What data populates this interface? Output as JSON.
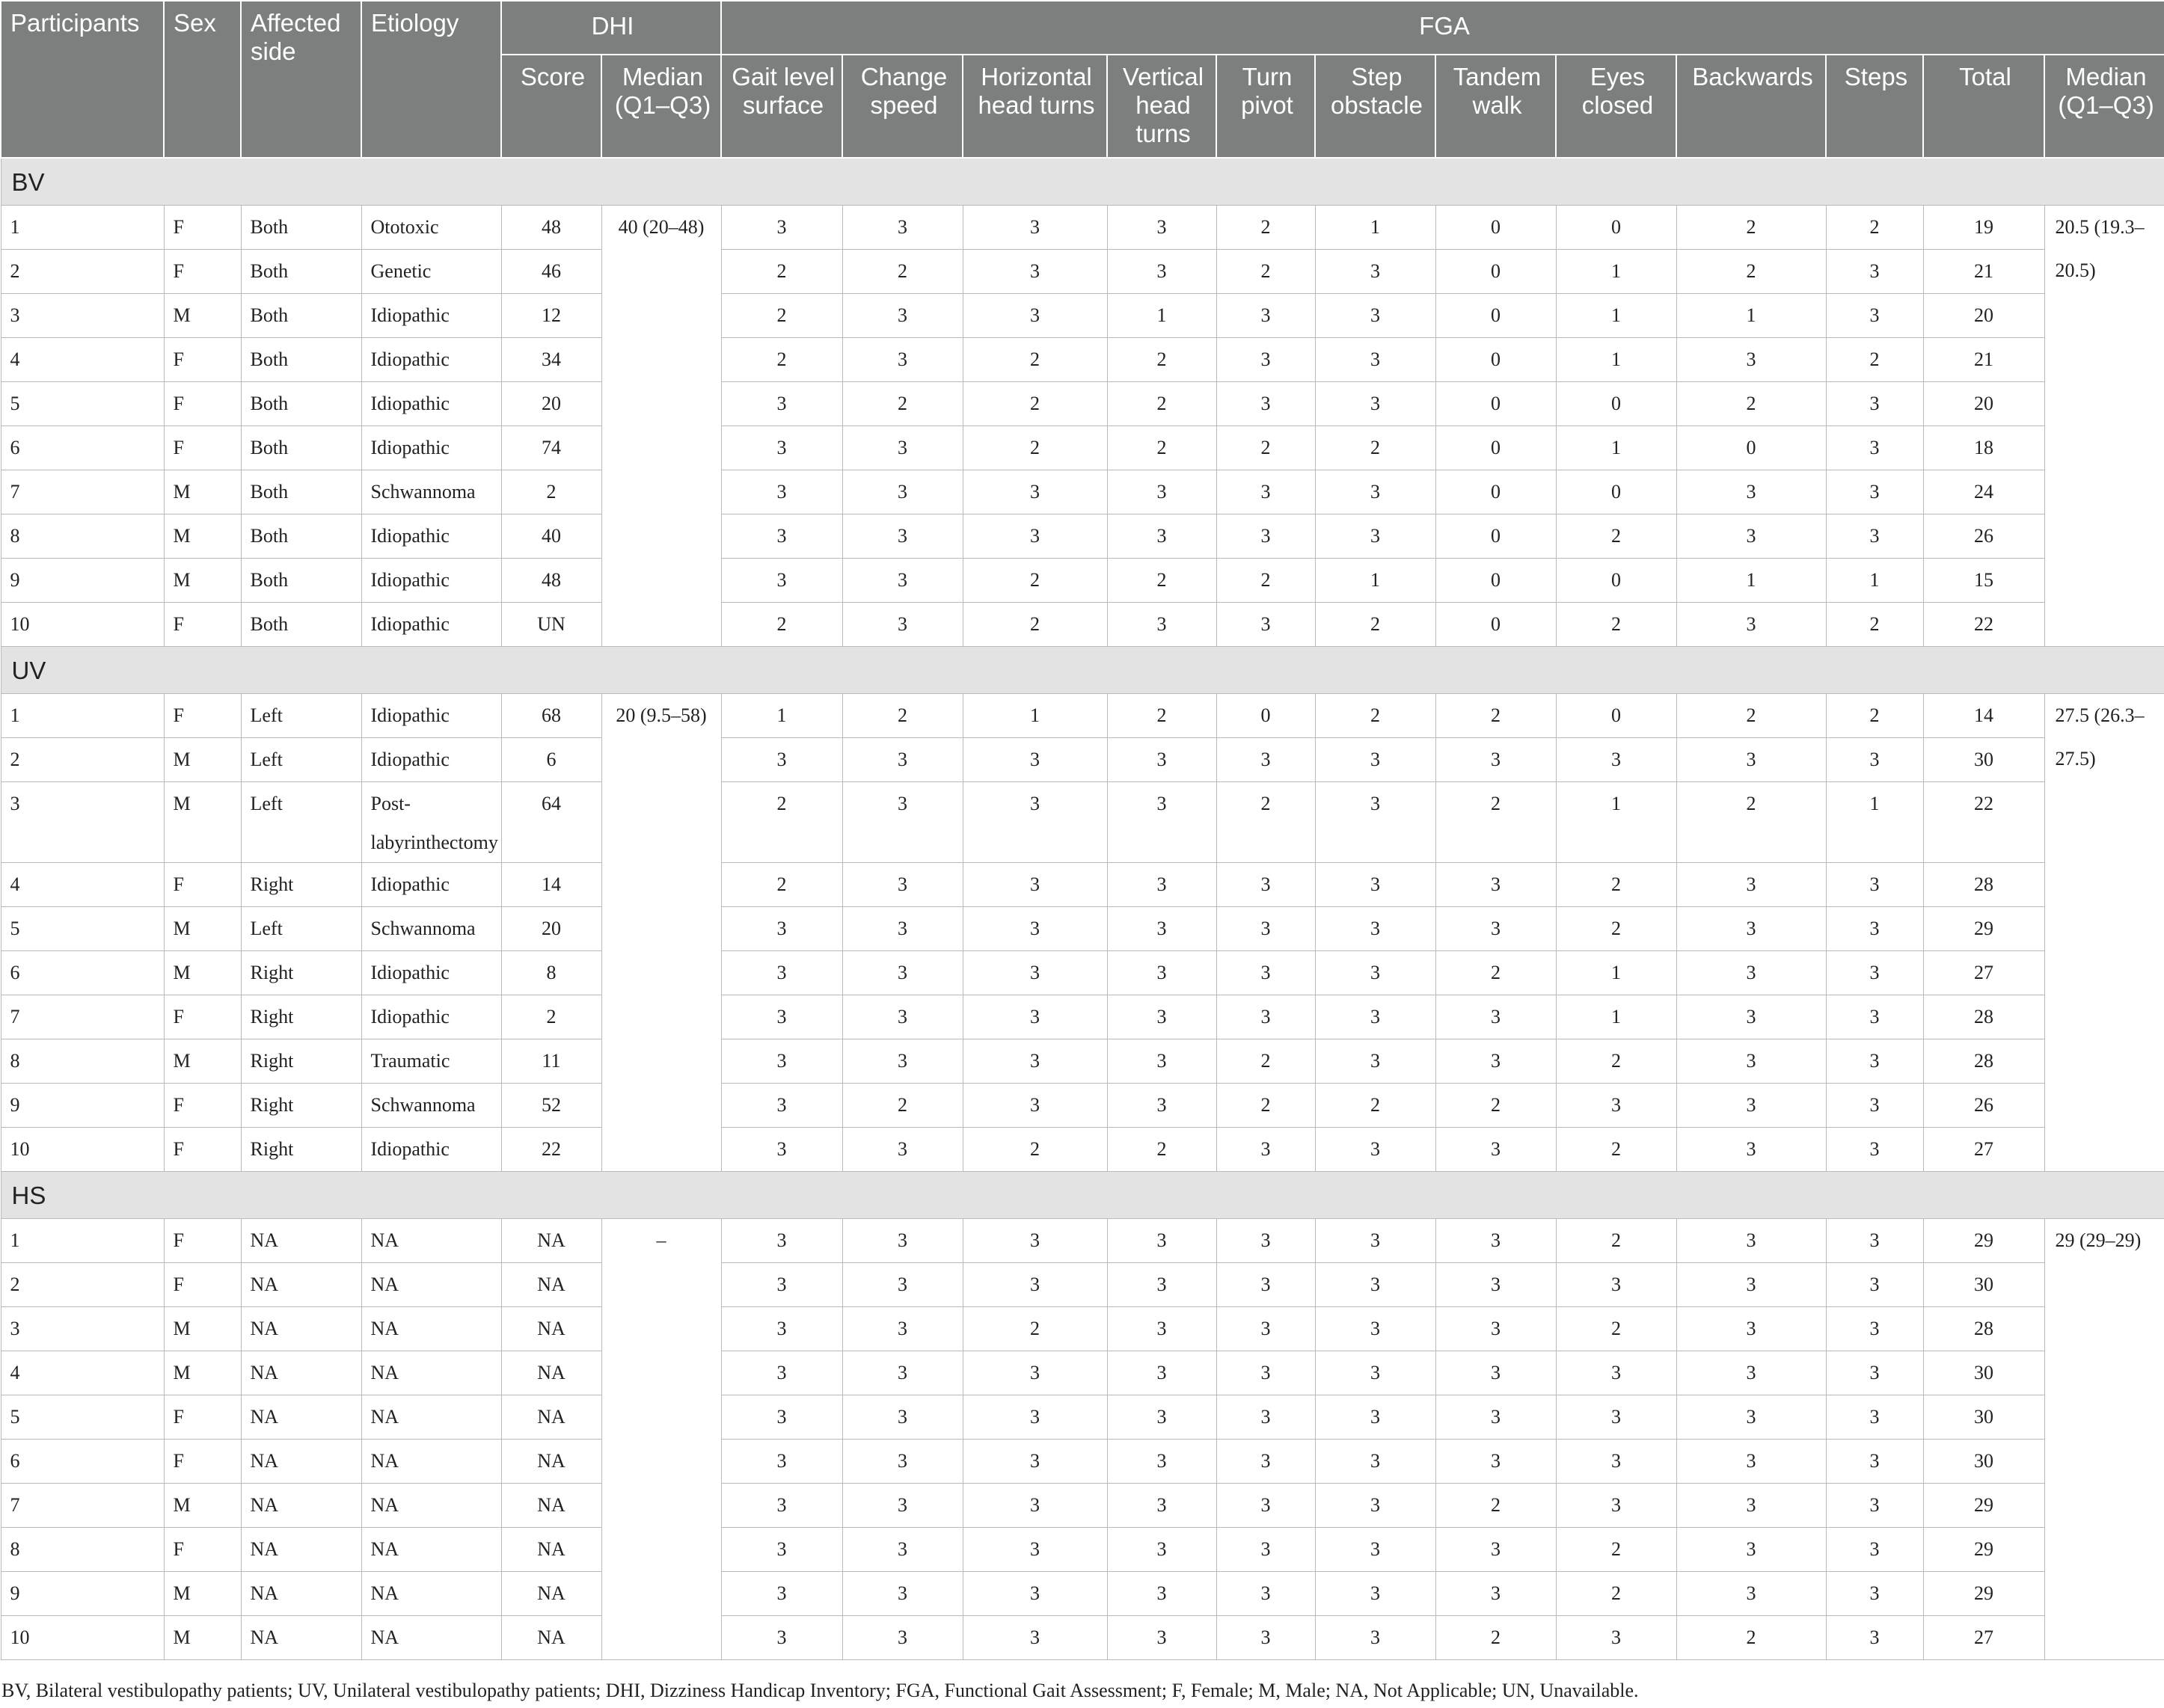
{
  "header": {
    "participants": "Participants",
    "sex": "Sex",
    "affected_side": "Affected side",
    "etiology": "Etiology",
    "dhi": "DHI",
    "fga": "FGA",
    "dhi_cols": [
      "Score",
      "Median (Q1–Q3)"
    ],
    "fga_cols": [
      "Gait level surface",
      "Change speed",
      "Horizontal head turns",
      "Vertical head turns",
      "Turn pivot",
      "Step obstacle",
      "Tandem walk",
      "Eyes closed",
      "Backwards",
      "Steps",
      "Total",
      "Median (Q1–Q3)"
    ]
  },
  "groups": [
    {
      "label": "BV",
      "dhi_median": "40 (20–48)",
      "fga_median": "20.5 (19.3–20.5)",
      "rows": [
        [
          "1",
          "F",
          "Both",
          "Ototoxic",
          "48",
          "3",
          "3",
          "3",
          "3",
          "2",
          "1",
          "0",
          "0",
          "2",
          "2",
          "19"
        ],
        [
          "2",
          "F",
          "Both",
          "Genetic",
          "46",
          "2",
          "2",
          "3",
          "3",
          "2",
          "3",
          "0",
          "1",
          "2",
          "3",
          "21"
        ],
        [
          "3",
          "M",
          "Both",
          "Idiopathic",
          "12",
          "2",
          "3",
          "3",
          "1",
          "3",
          "3",
          "0",
          "1",
          "1",
          "3",
          "20"
        ],
        [
          "4",
          "F",
          "Both",
          "Idiopathic",
          "34",
          "2",
          "3",
          "2",
          "2",
          "3",
          "3",
          "0",
          "1",
          "3",
          "2",
          "21"
        ],
        [
          "5",
          "F",
          "Both",
          "Idiopathic",
          "20",
          "3",
          "2",
          "2",
          "2",
          "3",
          "3",
          "0",
          "0",
          "2",
          "3",
          "20"
        ],
        [
          "6",
          "F",
          "Both",
          "Idiopathic",
          "74",
          "3",
          "3",
          "2",
          "2",
          "2",
          "2",
          "0",
          "1",
          "0",
          "3",
          "18"
        ],
        [
          "7",
          "M",
          "Both",
          "Schwannoma",
          "2",
          "3",
          "3",
          "3",
          "3",
          "3",
          "3",
          "0",
          "0",
          "3",
          "3",
          "24"
        ],
        [
          "8",
          "M",
          "Both",
          "Idiopathic",
          "40",
          "3",
          "3",
          "3",
          "3",
          "3",
          "3",
          "0",
          "2",
          "3",
          "3",
          "26"
        ],
        [
          "9",
          "M",
          "Both",
          "Idiopathic",
          "48",
          "3",
          "3",
          "2",
          "2",
          "2",
          "1",
          "0",
          "0",
          "1",
          "1",
          "15"
        ],
        [
          "10",
          "F",
          "Both",
          "Idiopathic",
          "UN",
          "2",
          "3",
          "2",
          "3",
          "3",
          "2",
          "0",
          "2",
          "3",
          "2",
          "22"
        ]
      ]
    },
    {
      "label": "UV",
      "dhi_median": "20 (9.5–58)",
      "fga_median": "27.5 (26.3–27.5)",
      "rows": [
        [
          "1",
          "F",
          "Left",
          "Idiopathic",
          "68",
          "1",
          "2",
          "1",
          "2",
          "0",
          "2",
          "2",
          "0",
          "2",
          "2",
          "14"
        ],
        [
          "2",
          "M",
          "Left",
          "Idiopathic",
          "6",
          "3",
          "3",
          "3",
          "3",
          "3",
          "3",
          "3",
          "3",
          "3",
          "3",
          "30"
        ],
        [
          "3",
          "M",
          "Left",
          "Post-labyrinthectomy",
          "64",
          "2",
          "3",
          "3",
          "3",
          "2",
          "3",
          "2",
          "1",
          "2",
          "1",
          "22"
        ],
        [
          "4",
          "F",
          "Right",
          "Idiopathic",
          "14",
          "2",
          "3",
          "3",
          "3",
          "3",
          "3",
          "3",
          "2",
          "3",
          "3",
          "28"
        ],
        [
          "5",
          "M",
          "Left",
          "Schwannoma",
          "20",
          "3",
          "3",
          "3",
          "3",
          "3",
          "3",
          "3",
          "2",
          "3",
          "3",
          "29"
        ],
        [
          "6",
          "M",
          "Right",
          "Idiopathic",
          "8",
          "3",
          "3",
          "3",
          "3",
          "3",
          "3",
          "2",
          "1",
          "3",
          "3",
          "27"
        ],
        [
          "7",
          "F",
          "Right",
          "Idiopathic",
          "2",
          "3",
          "3",
          "3",
          "3",
          "3",
          "3",
          "3",
          "1",
          "3",
          "3",
          "28"
        ],
        [
          "8",
          "M",
          "Right",
          "Traumatic",
          "11",
          "3",
          "3",
          "3",
          "3",
          "2",
          "3",
          "3",
          "2",
          "3",
          "3",
          "28"
        ],
        [
          "9",
          "F",
          "Right",
          "Schwannoma",
          "52",
          "3",
          "2",
          "3",
          "3",
          "2",
          "2",
          "2",
          "3",
          "3",
          "3",
          "26"
        ],
        [
          "10",
          "F",
          "Right",
          "Idiopathic",
          "22",
          "3",
          "3",
          "2",
          "2",
          "3",
          "3",
          "3",
          "2",
          "3",
          "3",
          "27"
        ]
      ]
    },
    {
      "label": "HS",
      "dhi_median": "–",
      "fga_median": "29 (29–29)",
      "rows": [
        [
          "1",
          "F",
          "NA",
          "NA",
          "NA",
          "3",
          "3",
          "3",
          "3",
          "3",
          "3",
          "3",
          "2",
          "3",
          "3",
          "29"
        ],
        [
          "2",
          "F",
          "NA",
          "NA",
          "NA",
          "3",
          "3",
          "3",
          "3",
          "3",
          "3",
          "3",
          "3",
          "3",
          "3",
          "30"
        ],
        [
          "3",
          "M",
          "NA",
          "NA",
          "NA",
          "3",
          "3",
          "2",
          "3",
          "3",
          "3",
          "3",
          "2",
          "3",
          "3",
          "28"
        ],
        [
          "4",
          "M",
          "NA",
          "NA",
          "NA",
          "3",
          "3",
          "3",
          "3",
          "3",
          "3",
          "3",
          "3",
          "3",
          "3",
          "30"
        ],
        [
          "5",
          "F",
          "NA",
          "NA",
          "NA",
          "3",
          "3",
          "3",
          "3",
          "3",
          "3",
          "3",
          "3",
          "3",
          "3",
          "30"
        ],
        [
          "6",
          "F",
          "NA",
          "NA",
          "NA",
          "3",
          "3",
          "3",
          "3",
          "3",
          "3",
          "3",
          "3",
          "3",
          "3",
          "30"
        ],
        [
          "7",
          "M",
          "NA",
          "NA",
          "NA",
          "3",
          "3",
          "3",
          "3",
          "3",
          "3",
          "2",
          "3",
          "3",
          "3",
          "29"
        ],
        [
          "8",
          "F",
          "NA",
          "NA",
          "NA",
          "3",
          "3",
          "3",
          "3",
          "3",
          "3",
          "3",
          "2",
          "3",
          "3",
          "29"
        ],
        [
          "9",
          "M",
          "NA",
          "NA",
          "NA",
          "3",
          "3",
          "3",
          "3",
          "3",
          "3",
          "3",
          "2",
          "3",
          "3",
          "29"
        ],
        [
          "10",
          "M",
          "NA",
          "NA",
          "NA",
          "3",
          "3",
          "3",
          "3",
          "3",
          "3",
          "2",
          "3",
          "2",
          "3",
          "27"
        ]
      ]
    }
  ],
  "footnote": "BV, Bilateral vestibulopathy patients; UV, Unilateral vestibulopathy patients; DHI, Dizziness Handicap Inventory; FGA, Functional Gait Assessment; F, Female; M, Male; NA, Not Applicable; UN, Unavailable."
}
